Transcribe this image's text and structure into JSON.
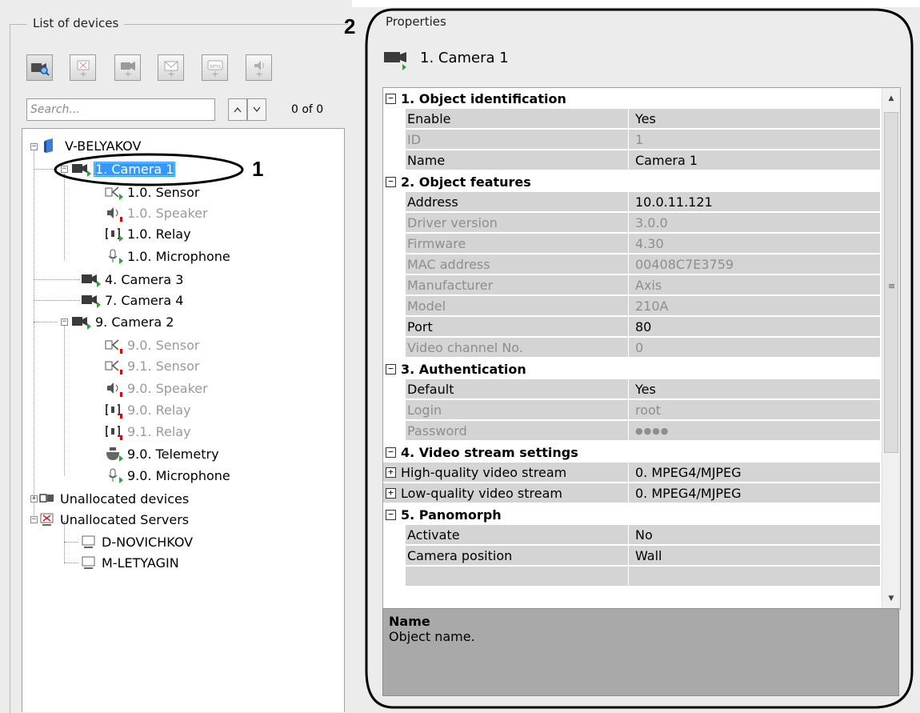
{
  "left_panel": {
    "title": "List of devices",
    "toolbar": [
      {
        "name": "camera-search-button",
        "icon": "camera-search-icon"
      },
      {
        "name": "add-unknown-device-button",
        "icon": "add-device-icon"
      },
      {
        "name": "add-camera-button",
        "icon": "add-camera-icon"
      },
      {
        "name": "add-mail-button",
        "icon": "add-mail-icon"
      },
      {
        "name": "add-sms-button",
        "icon": "add-sms-icon",
        "text": "sms"
      },
      {
        "name": "add-speaker-button",
        "icon": "add-speaker-icon"
      }
    ],
    "search": {
      "placeholder": "Search...",
      "value": "",
      "count": "0 of 0"
    },
    "tree": [
      {
        "label": "V-BELYAKOV"
      },
      {
        "label": "1. Camera 1"
      },
      {
        "label": "1.0. Sensor"
      },
      {
        "label": "1.0. Speaker"
      },
      {
        "label": "1.0. Relay"
      },
      {
        "label": "1.0. Microphone"
      },
      {
        "label": "4. Camera 3"
      },
      {
        "label": "7. Camera 4"
      },
      {
        "label": "9. Camera 2"
      },
      {
        "label": "9.0. Sensor"
      },
      {
        "label": "9.1. Sensor"
      },
      {
        "label": "9.0. Speaker"
      },
      {
        "label": "9.0. Relay"
      },
      {
        "label": "9.1. Relay"
      },
      {
        "label": "9.0. Telemetry"
      },
      {
        "label": "9.0. Microphone"
      },
      {
        "label": "Unallocated devices"
      },
      {
        "label": "Unallocated Servers"
      },
      {
        "label": "D-NOVICHKOV"
      },
      {
        "label": "M-LETYAGIN"
      }
    ]
  },
  "right_panel": {
    "title": "Properties",
    "object_name": "1. Camera 1",
    "categories": {
      "identification": "1. Object identification",
      "features": "2. Object features",
      "authentication": "3. Authentication",
      "video": "4. Video stream settings",
      "panomorph": "5. Panomorph"
    },
    "properties": [
      {
        "name": "Enable",
        "value": "Yes"
      },
      {
        "name": "ID",
        "value": "1"
      },
      {
        "name": "Name",
        "value": "Camera 1"
      },
      {
        "name": "Address",
        "value": "10.0.11.121"
      },
      {
        "name": "Driver version",
        "value": "3.0.0"
      },
      {
        "name": "Firmware",
        "value": "4.30"
      },
      {
        "name": "MAC address",
        "value": "00408C7E3759"
      },
      {
        "name": "Manufacturer",
        "value": "Axis"
      },
      {
        "name": "Model",
        "value": "210A"
      },
      {
        "name": "Port",
        "value": "80"
      },
      {
        "name": "Video channel No.",
        "value": "0"
      },
      {
        "name": "Default",
        "value": "Yes"
      },
      {
        "name": "Login",
        "value": "root"
      },
      {
        "name": "Password",
        "value": "●●●●"
      },
      {
        "name": "High-quality video stream",
        "value": "0. MPEG4/MJPEG"
      },
      {
        "name": "Low-quality video stream",
        "value": "0. MPEG4/MJPEG"
      },
      {
        "name": "Activate",
        "value": "No"
      },
      {
        "name": "Camera position",
        "value": "Wall"
      }
    ],
    "description": {
      "title": "Name",
      "text": "Object name."
    }
  },
  "callouts": {
    "one": "1",
    "two": "2"
  }
}
